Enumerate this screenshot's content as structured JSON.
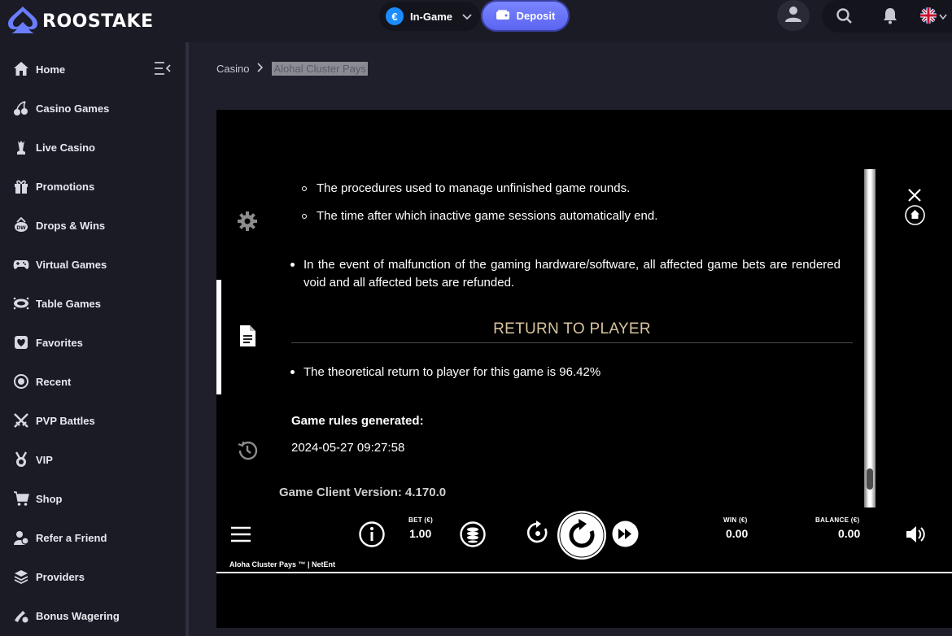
{
  "brand": {
    "name": "ROOSTAKE"
  },
  "header": {
    "wallet_label": "In-Game",
    "currency_symbol": "€",
    "deposit_label": "Deposit"
  },
  "sidebar": {
    "items": [
      {
        "label": "Home",
        "icon": "home-icon"
      },
      {
        "label": "Casino Games",
        "icon": "cherries-icon"
      },
      {
        "label": "Live Casino",
        "icon": "chess-icon"
      },
      {
        "label": "Promotions",
        "icon": "gift-icon"
      },
      {
        "label": "Drops & Wins",
        "icon": "drops-icon"
      },
      {
        "label": "Virtual Games",
        "icon": "gamepad-icon"
      },
      {
        "label": "Table Games",
        "icon": "table-icon"
      },
      {
        "label": "Favorites",
        "icon": "heart-icon"
      },
      {
        "label": "Recent",
        "icon": "recent-icon"
      },
      {
        "label": "PVP Battles",
        "icon": "swords-icon"
      },
      {
        "label": "VIP",
        "icon": "medal-icon"
      },
      {
        "label": "Shop",
        "icon": "cart-icon"
      },
      {
        "label": "Refer a Friend",
        "icon": "refer-icon"
      },
      {
        "label": "Providers",
        "icon": "providers-icon"
      },
      {
        "label": "Bonus Wagering",
        "icon": "wagering-icon"
      }
    ]
  },
  "breadcrumb": {
    "root": "Casino",
    "current": "Alohal Cluster Pays"
  },
  "rules": {
    "sub_bullets": [
      "The procedures used to manage unfinished game rounds.",
      "The time after which inactive game sessions automatically end."
    ],
    "malfunction": "In the event of malfunction of the gaming hardware/software, all affected game bets are rendered void and all affected bets are refunded.",
    "rtp_heading": "RETURN TO PLAYER",
    "rtp_text": "The theoretical return to player for this game is 96.42%",
    "generated_label": "Game rules generated:",
    "generated_date": "2024-05-27 09:27:58",
    "client_version": "Game Client Version: 4.170.0"
  },
  "game": {
    "bet_label": "BET (€)",
    "bet_value": "1.00",
    "win_label": "WIN (€)",
    "win_value": "0.00",
    "balance_label": "BALANCE (€)",
    "balance_value": "0.00",
    "footer": "Aloha Cluster Pays ™  |  NetEnt"
  },
  "colors": {
    "rtp_heading": "#d8c49c",
    "deposit_button": "#6670f8",
    "page_bg": "#1f1f2b"
  }
}
